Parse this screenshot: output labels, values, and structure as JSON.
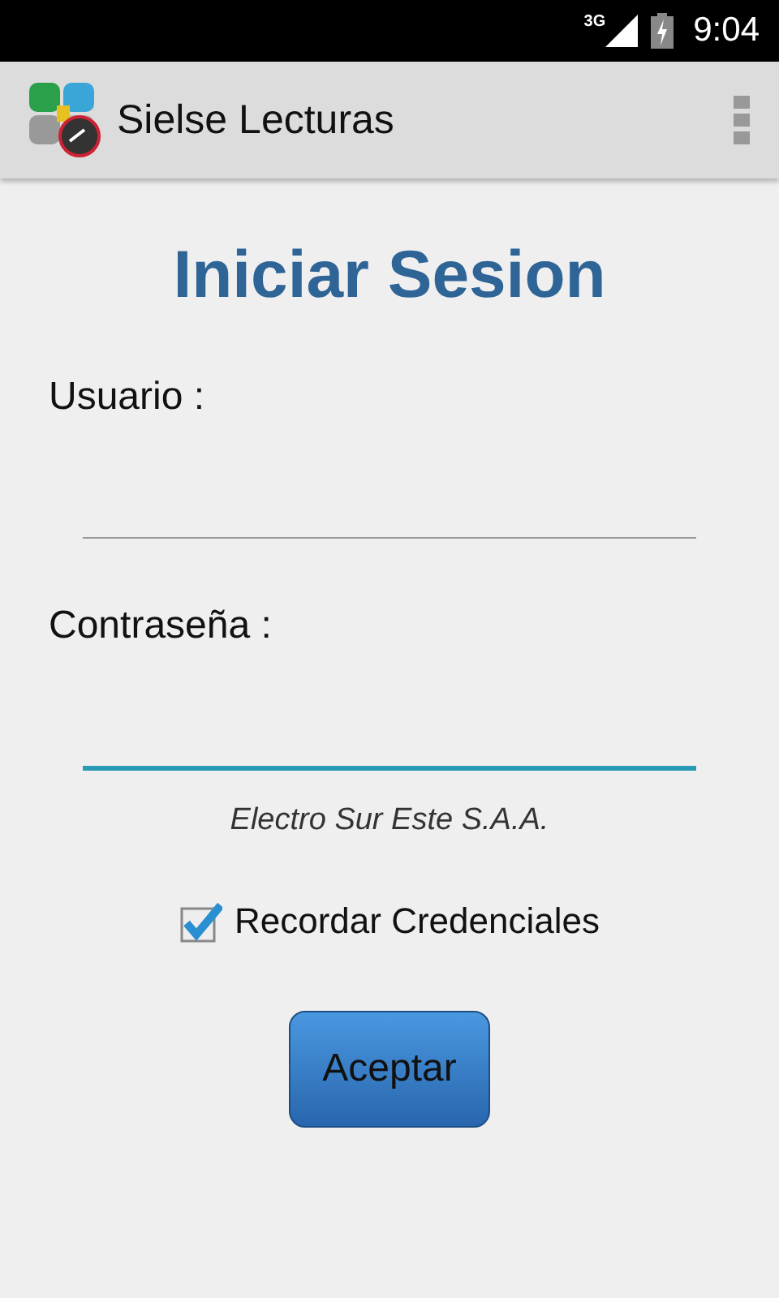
{
  "status_bar": {
    "network": "3G",
    "time": "9:04"
  },
  "app_bar": {
    "title": "Sielse Lecturas"
  },
  "heading": "Iniciar Sesion",
  "fields": [
    {
      "label": "Usuario :",
      "focused": false
    },
    {
      "label": "Contraseña :",
      "focused": true
    }
  ],
  "company": "Electro Sur Este S.A.A.",
  "remember": {
    "label": "Recordar Credenciales",
    "checked": true
  },
  "button": "Aceptar"
}
